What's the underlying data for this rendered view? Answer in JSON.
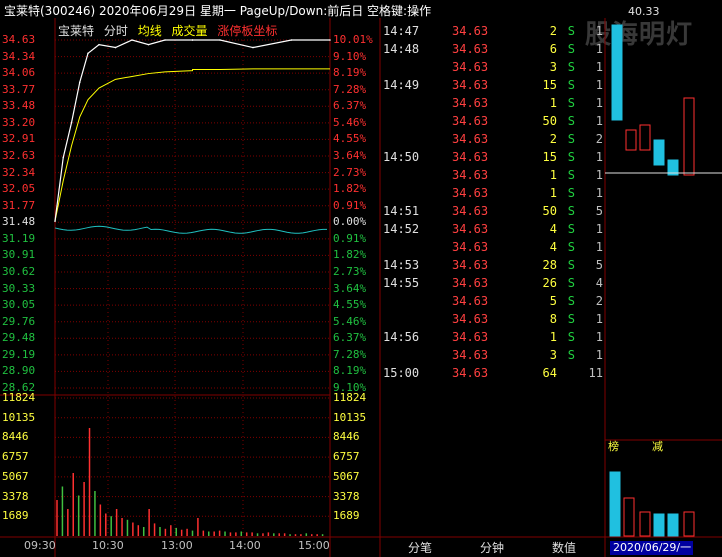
{
  "title": "宝莱特(300246)  2020年06月29日 星期一 PageUp/Down:前后日 空格键:操作",
  "watermark": "股海明灯",
  "legend": {
    "name": "宝莱特",
    "tab_time": "分时",
    "avg": "均线",
    "vol": "成交量",
    "limit": "涨停板坐标"
  },
  "colors": {
    "up": "#ff3030",
    "down": "#20c0c0",
    "price_line": "#ffffff",
    "avg_line": "#ffff00",
    "grid": "#800000",
    "flat": "#e0e0e0"
  },
  "price_ticks": [
    "34.63",
    "34.34",
    "34.06",
    "33.77",
    "33.48",
    "33.20",
    "32.91",
    "32.63",
    "32.34",
    "32.05",
    "31.77",
    "31.48",
    "31.19",
    "30.91",
    "30.62",
    "30.33",
    "30.05",
    "29.76",
    "29.48",
    "29.19",
    "28.90",
    "28.62"
  ],
  "pct_ticks": [
    "10.01%",
    "9.10%",
    "8.19%",
    "7.28%",
    "6.37%",
    "5.46%",
    "4.55%",
    "3.64%",
    "2.73%",
    "1.82%",
    "0.91%",
    "0.00%",
    "0.91%",
    "1.82%",
    "2.73%",
    "3.64%",
    "4.55%",
    "5.46%",
    "6.37%",
    "7.28%",
    "8.19%",
    "9.10%"
  ],
  "volume_ticks": [
    "11824",
    "10135",
    "8446",
    "6757",
    "5067",
    "3378",
    "1689"
  ],
  "time_ticks": [
    "09:30",
    "10:30",
    "13:00",
    "14:00",
    "15:00"
  ],
  "chart_data": {
    "type": "line",
    "title": "宝莱特(300246)",
    "ylim": [
      28.33,
      34.63
    ],
    "prev_close": 31.48,
    "x": [
      "09:30",
      "09:35",
      "09:40",
      "09:45",
      "09:50",
      "10:00",
      "10:15",
      "10:30",
      "10:45",
      "11:00",
      "11:30",
      "13:00",
      "13:30",
      "14:00",
      "14:30",
      "15:00"
    ],
    "series": [
      {
        "name": "分时",
        "values": [
          31.5,
          32.6,
          33.2,
          33.9,
          34.4,
          34.55,
          34.5,
          34.63,
          34.55,
          34.63,
          34.63,
          34.63,
          34.63,
          34.5,
          34.63,
          34.63
        ]
      },
      {
        "name": "均线",
        "values": [
          31.5,
          32.2,
          32.8,
          33.3,
          33.6,
          33.8,
          33.95,
          34.0,
          34.05,
          34.08,
          34.1,
          34.12,
          34.12,
          34.13,
          34.13,
          34.13
        ]
      }
    ],
    "volume_max": 11824
  },
  "trades": [
    {
      "time": "14:47",
      "price": "34.63",
      "vol": "2",
      "dir": "S",
      "cnt": "1"
    },
    {
      "time": "14:48",
      "price": "34.63",
      "vol": "6",
      "dir": "S",
      "cnt": "1"
    },
    {
      "time": "",
      "price": "34.63",
      "vol": "3",
      "dir": "S",
      "cnt": "1"
    },
    {
      "time": "14:49",
      "price": "34.63",
      "vol": "15",
      "dir": "S",
      "cnt": "1"
    },
    {
      "time": "",
      "price": "34.63",
      "vol": "1",
      "dir": "S",
      "cnt": "1"
    },
    {
      "time": "",
      "price": "34.63",
      "vol": "50",
      "dir": "S",
      "cnt": "1"
    },
    {
      "time": "",
      "price": "34.63",
      "vol": "2",
      "dir": "S",
      "cnt": "2"
    },
    {
      "time": "14:50",
      "price": "34.63",
      "vol": "15",
      "dir": "S",
      "cnt": "1"
    },
    {
      "time": "",
      "price": "34.63",
      "vol": "1",
      "dir": "S",
      "cnt": "1"
    },
    {
      "time": "",
      "price": "34.63",
      "vol": "1",
      "dir": "S",
      "cnt": "1"
    },
    {
      "time": "14:51",
      "price": "34.63",
      "vol": "50",
      "dir": "S",
      "cnt": "5"
    },
    {
      "time": "14:52",
      "price": "34.63",
      "vol": "4",
      "dir": "S",
      "cnt": "1"
    },
    {
      "time": "",
      "price": "34.63",
      "vol": "4",
      "dir": "S",
      "cnt": "1"
    },
    {
      "time": "14:53",
      "price": "34.63",
      "vol": "28",
      "dir": "S",
      "cnt": "5"
    },
    {
      "time": "14:55",
      "price": "34.63",
      "vol": "26",
      "dir": "S",
      "cnt": "4"
    },
    {
      "time": "",
      "price": "34.63",
      "vol": "5",
      "dir": "S",
      "cnt": "2"
    },
    {
      "time": "",
      "price": "34.63",
      "vol": "8",
      "dir": "S",
      "cnt": "1"
    },
    {
      "time": "14:56",
      "price": "34.63",
      "vol": "1",
      "dir": "S",
      "cnt": "1"
    },
    {
      "time": "",
      "price": "34.63",
      "vol": "3",
      "dir": "S",
      "cnt": "1"
    },
    {
      "time": "15:00",
      "price": "34.63",
      "vol": "64",
      "dir": "",
      "cnt": "11"
    }
  ],
  "bottom_tabs": [
    "分笔",
    "分钟",
    "数值"
  ],
  "right_panel": {
    "top_price": "40.33",
    "label_a": "榜",
    "label_b": "减",
    "date": "2020/06/29/一"
  }
}
